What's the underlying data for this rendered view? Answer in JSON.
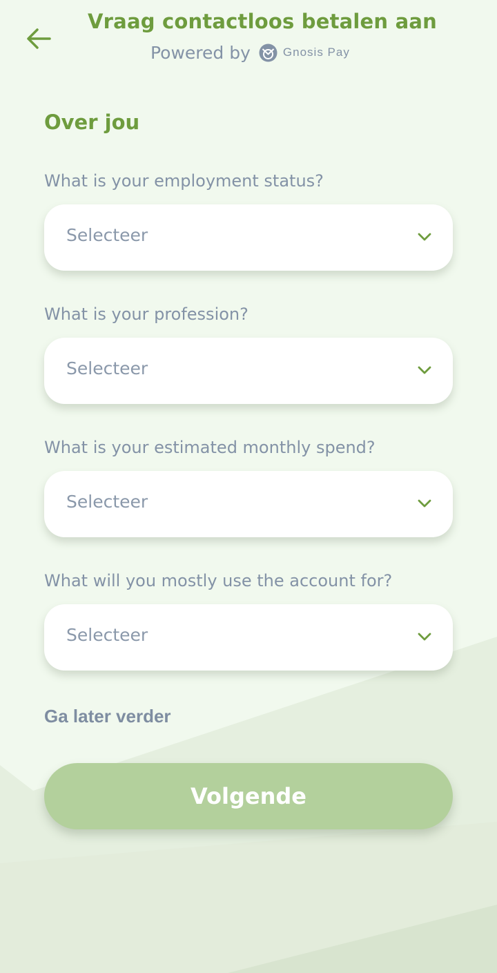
{
  "header": {
    "title": "Vraag contactloos betalen aan",
    "powered_by": "Powered by",
    "brand": "Gnosis Pay"
  },
  "section": {
    "title": "Over jou"
  },
  "fields": [
    {
      "label": "What is your employment status?",
      "value": "Selecteer"
    },
    {
      "label": "What is your profession?",
      "value": "Selecteer"
    },
    {
      "label": "What is your estimated monthly spend?",
      "value": "Selecteer"
    },
    {
      "label": "What will you mostly use the account for?",
      "value": "Selecteer"
    }
  ],
  "actions": {
    "later_label": "Ga later verder",
    "next_label": "Volgende"
  },
  "icons": {
    "back": "arrow-left-icon",
    "brand": "gnosis-logo-icon",
    "dropdown": "chevron-down-icon"
  },
  "colors": {
    "accent": "#6e9c3e",
    "button": "#b3d09c",
    "muted_text": "#8392a6",
    "background": "#f1f9ee",
    "background_shape": "#e3eddb"
  }
}
